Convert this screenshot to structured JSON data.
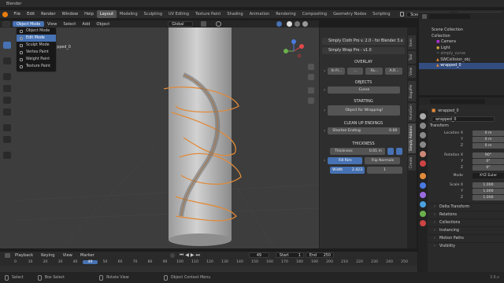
{
  "titlebar": {
    "title": "Blender"
  },
  "menus": [
    "File",
    "Edit",
    "Render",
    "Window",
    "Help"
  ],
  "workspaces": [
    "Layout",
    "Modeling",
    "Sculpting",
    "UV Editing",
    "Texture Paint",
    "Shading",
    "Animation",
    "Rendering",
    "Compositing",
    "Geometry Nodes",
    "Scripting"
  ],
  "active_workspace": "Layout",
  "scene": {
    "label": "Scene",
    "view_layer": "ViewLayer"
  },
  "viewport_header": {
    "mode": "Object Mode",
    "menus": [
      "View",
      "Select",
      "Add",
      "Object"
    ],
    "orientation": "Global",
    "options": "Options"
  },
  "viewport": {
    "object_label": "(1) | wrapped_0"
  },
  "mode_dropdown": {
    "items": [
      "Object Mode",
      "Edit Mode",
      "Sculpt Mode",
      "Vertex Paint",
      "Weight Paint",
      "Texture Paint"
    ],
    "highlighted": "Edit Mode"
  },
  "npanel": {
    "header1": "Simply Cloth Pro v. 2.0 - for Blender 3.x",
    "header2": "Simply Wrap Pro - v1.0",
    "overlay_label": "OVERLAY",
    "overlay_buttons": [
      "In Fr...",
      "...",
      "Fa...",
      "A.R..."
    ],
    "objects_label": "OBJECTS",
    "objects_value": "Curve",
    "starting_label": "STARTING",
    "starting_button": "Object for Wrapping!",
    "cleanup_label": "CLEAN UP ENDINGS",
    "shorten_label": "Shorten Ending",
    "shorten_value": "0.66",
    "thickness_label": "THICKNESS",
    "thickness_field": "Thickness",
    "thickness_value": "0.01 m",
    "fill_rim": "Fill Rim",
    "flip_normals": "Flip Normals",
    "width_label": "Width",
    "width_value": "2.423",
    "width_value2": "1"
  },
  "vtabs": [
    "Item",
    "Tool",
    "View",
    "BagaPie",
    "HumGen",
    "Simply Addons",
    "Create"
  ],
  "outliner": {
    "rows": [
      {
        "label": "Scene Collection",
        "indent": 0
      },
      {
        "label": "Collection",
        "indent": 1
      },
      {
        "label": "Camera",
        "indent": 2
      },
      {
        "label": "Light",
        "indent": 2
      },
      {
        "label": "simply_curve",
        "indent": 2
      },
      {
        "label": "SWCollision_obj",
        "indent": 2
      },
      {
        "label": "wrapped_0",
        "indent": 2
      }
    ],
    "selected": "wrapped_0"
  },
  "properties": {
    "object_name": "wrapped_0",
    "data_name": "wrapped_0",
    "transform_label": "Transform",
    "location": {
      "label": "Location X",
      "x": "0 m",
      "y": "0 m",
      "z": "0 m"
    },
    "rotation": {
      "label": "Rotation X",
      "x": "90°",
      "y": "0°",
      "z": "0°"
    },
    "mode_label": "Mode",
    "mode_value": "XYZ Euler",
    "scale": {
      "label": "Scale X",
      "x": "1.000",
      "y": "1.000",
      "z": "1.000"
    },
    "axis": {
      "y": "Y",
      "z": "Z"
    },
    "sections": [
      "Delta Transform",
      "Relations",
      "Collections",
      "Instancing",
      "Motion Paths",
      "Visibility"
    ]
  },
  "timeline": {
    "menus": [
      "Playback",
      "Keying",
      "View",
      "Marker"
    ],
    "current_frame": "49",
    "start_label": "Start",
    "start": "1",
    "end_label": "End",
    "end": "250",
    "ticks": [
      "0",
      "10",
      "20",
      "30",
      "40",
      "49",
      "50",
      "60",
      "70",
      "80",
      "90",
      "100",
      "110",
      "120",
      "130",
      "140",
      "150",
      "160",
      "170",
      "180",
      "190",
      "200",
      "210",
      "220",
      "230",
      "240",
      "250"
    ]
  },
  "statusbar": {
    "select": "Select",
    "box_select": "Box Select",
    "rotate": "Rotate View",
    "context": "Object Context Menu",
    "version": "3.6.x"
  },
  "colors": {
    "accent": "#4772b3",
    "selection_outline": "#e08a3a",
    "viewport": "#3d3d3d"
  }
}
